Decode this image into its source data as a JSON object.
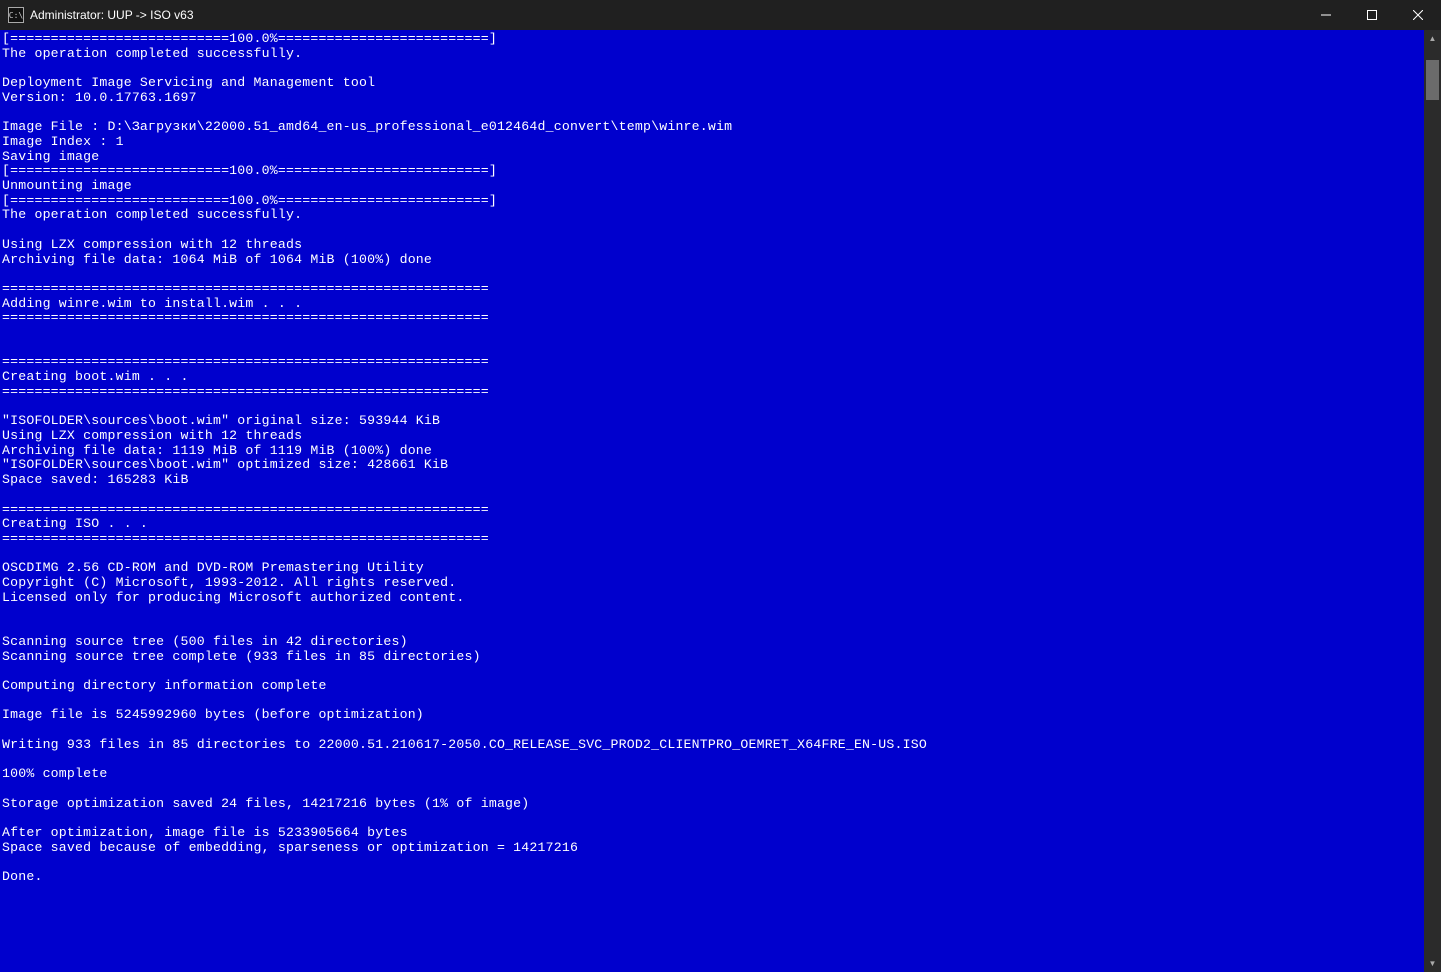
{
  "window": {
    "title": "Administrator:  UUP -> ISO v63",
    "icon_label": "C:\\"
  },
  "terminal": {
    "lines": [
      "[===========================100.0%==========================]",
      "The operation completed successfully.",
      "",
      "Deployment Image Servicing and Management tool",
      "Version: 10.0.17763.1697",
      "",
      "Image File : D:\\Загрузки\\22000.51_amd64_en-us_professional_e012464d_convert\\temp\\winre.wim",
      "Image Index : 1",
      "Saving image",
      "[===========================100.0%==========================]",
      "Unmounting image",
      "[===========================100.0%==========================]",
      "The operation completed successfully.",
      "",
      "Using LZX compression with 12 threads",
      "Archiving file data: 1064 MiB of 1064 MiB (100%) done",
      "",
      "============================================================",
      "Adding winre.wim to install.wim . . .",
      "============================================================",
      "",
      "",
      "============================================================",
      "Creating boot.wim . . .",
      "============================================================",
      "",
      "\"ISOFOLDER\\sources\\boot.wim\" original size: 593944 KiB",
      "Using LZX compression with 12 threads",
      "Archiving file data: 1119 MiB of 1119 MiB (100%) done",
      "\"ISOFOLDER\\sources\\boot.wim\" optimized size: 428661 KiB",
      "Space saved: 165283 KiB",
      "",
      "============================================================",
      "Creating ISO . . .",
      "============================================================",
      "",
      "OSCDIMG 2.56 CD-ROM and DVD-ROM Premastering Utility",
      "Copyright (C) Microsoft, 1993-2012. All rights reserved.",
      "Licensed only for producing Microsoft authorized content.",
      "",
      "",
      "Scanning source tree (500 files in 42 directories)",
      "Scanning source tree complete (933 files in 85 directories)",
      "",
      "Computing directory information complete",
      "",
      "Image file is 5245992960 bytes (before optimization)",
      "",
      "Writing 933 files in 85 directories to 22000.51.210617-2050.CO_RELEASE_SVC_PROD2_CLIENTPRO_OEMRET_X64FRE_EN-US.ISO",
      "",
      "100% complete",
      "",
      "Storage optimization saved 24 files, 14217216 bytes (1% of image)",
      "",
      "After optimization, image file is 5233905664 bytes",
      "Space saved because of embedding, sparseness or optimization = 14217216",
      "",
      "Done."
    ]
  }
}
